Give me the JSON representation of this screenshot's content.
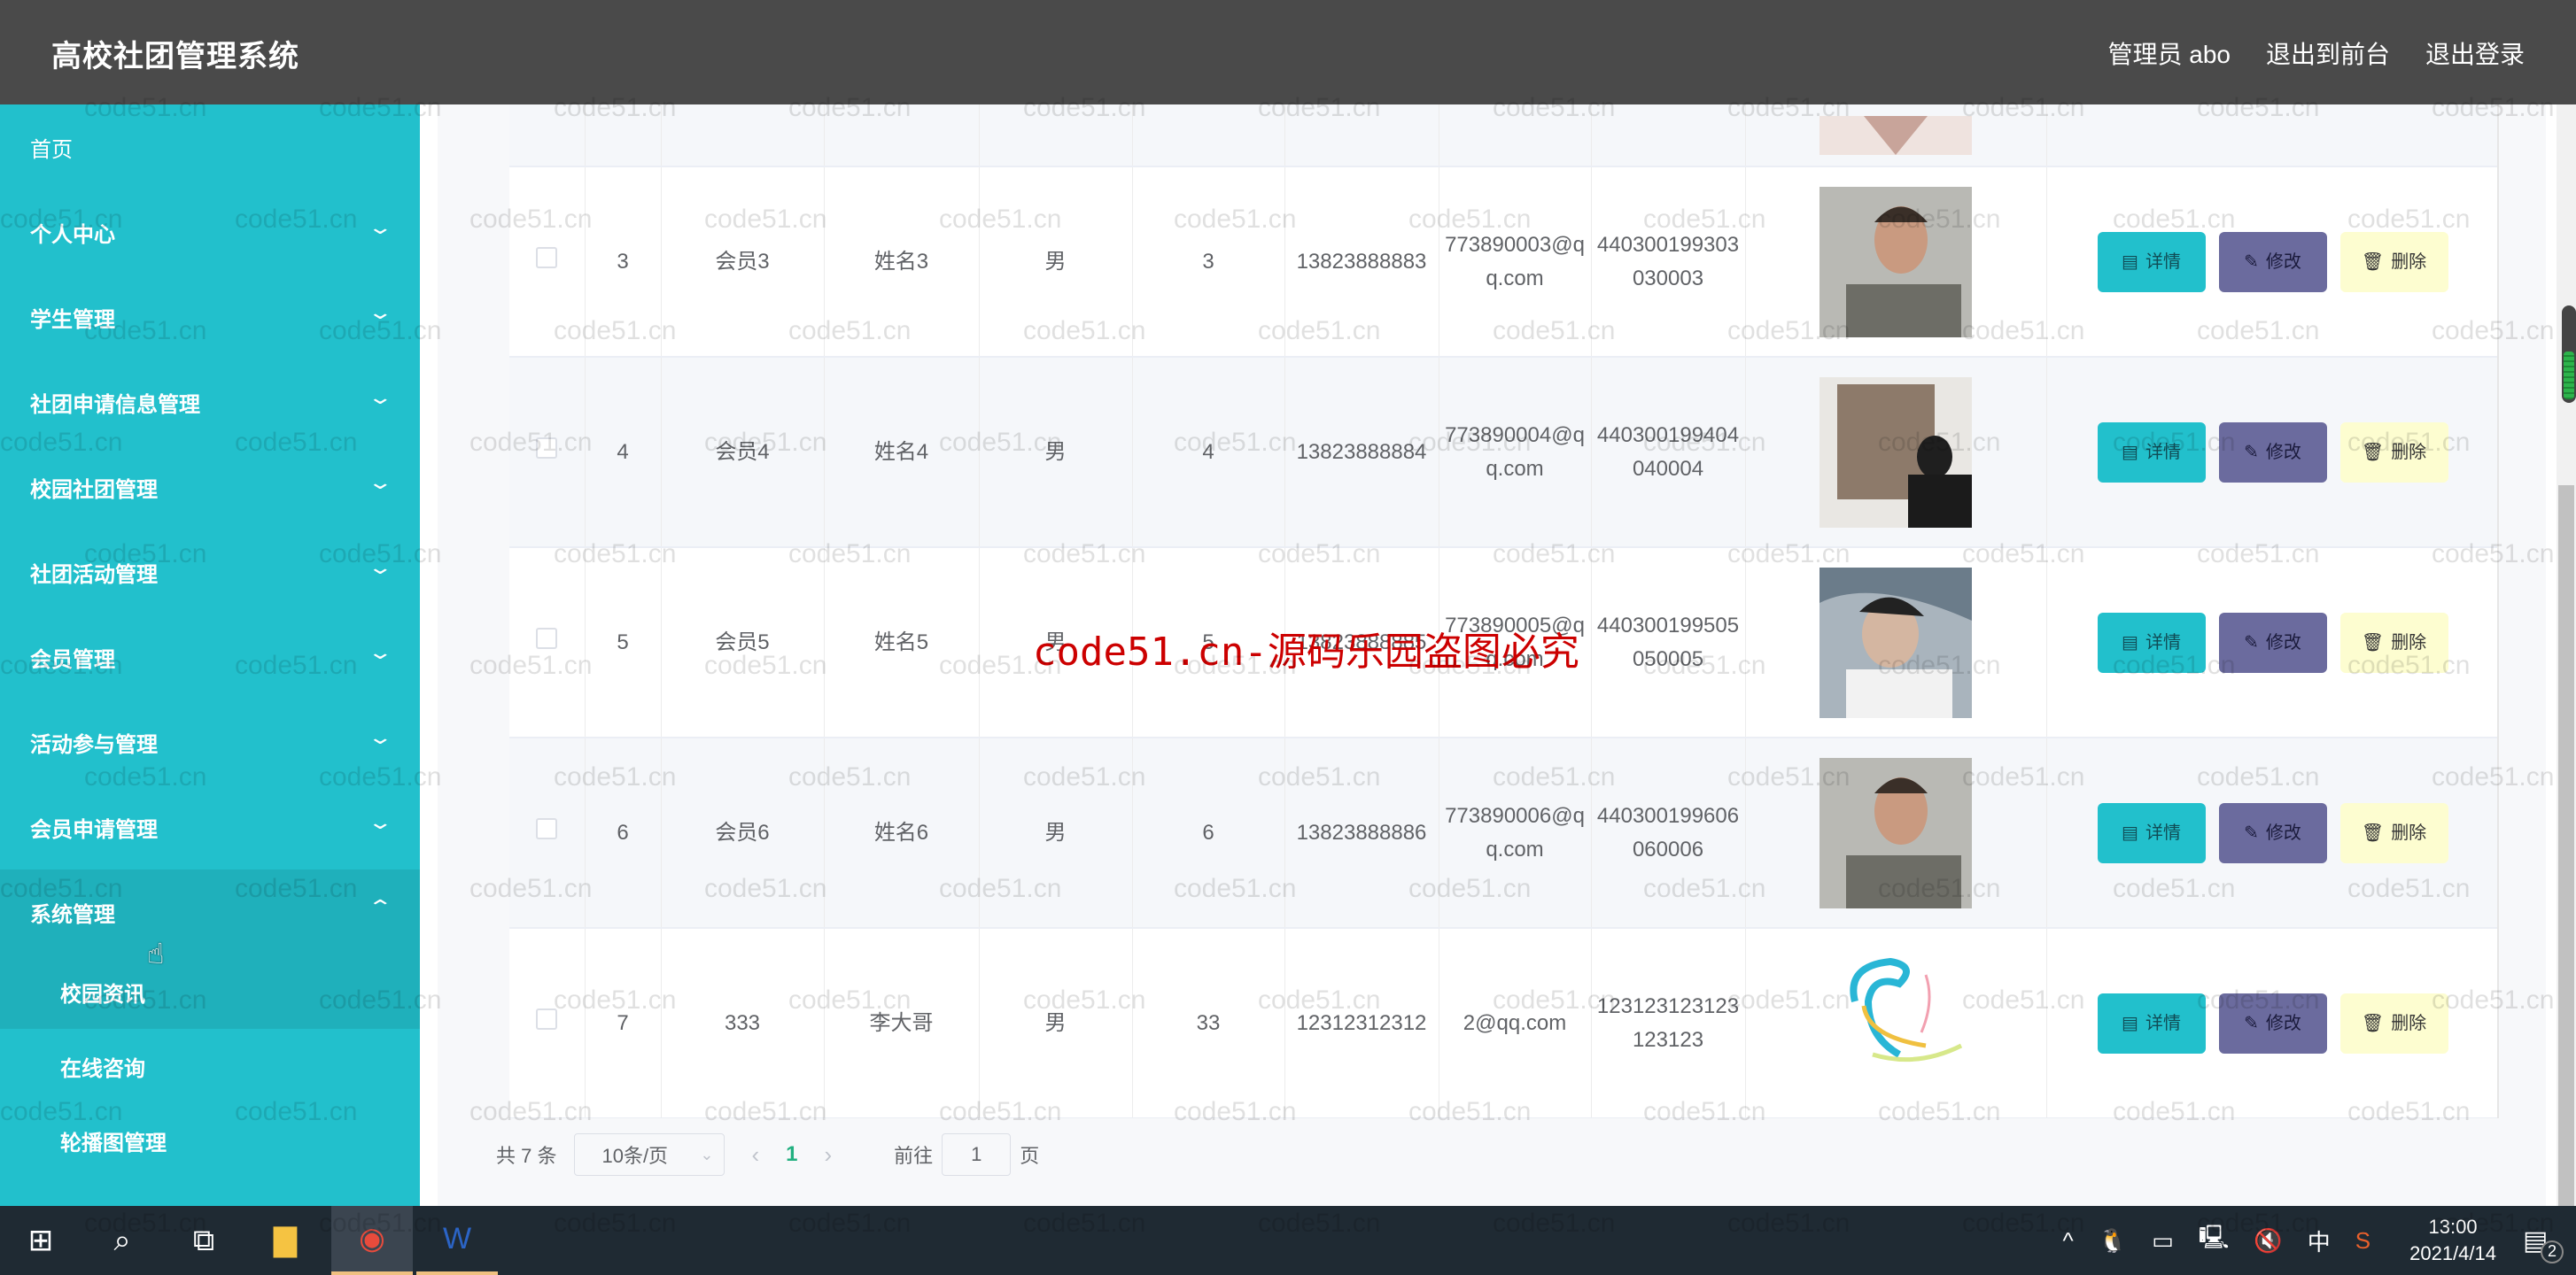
{
  "header": {
    "title": "高校社团管理系统",
    "user_label": "管理员 abo",
    "front_label": "退出到前台",
    "logout_label": "退出登录"
  },
  "sidebar": {
    "items": [
      {
        "label": "首页",
        "has_children": false
      },
      {
        "label": "个人中心",
        "has_children": true
      },
      {
        "label": "学生管理",
        "has_children": true
      },
      {
        "label": "社团申请信息管理",
        "has_children": true
      },
      {
        "label": "校园社团管理",
        "has_children": true
      },
      {
        "label": "社团活动管理",
        "has_children": true
      },
      {
        "label": "会员管理",
        "has_children": true
      },
      {
        "label": "活动参与管理",
        "has_children": true
      },
      {
        "label": "会员申请管理",
        "has_children": true
      },
      {
        "label": "系统管理",
        "has_children": true,
        "expanded": true
      }
    ],
    "sub_items": [
      "校园资讯",
      "在线咨询",
      "轮播图管理"
    ],
    "chevron_down": "⌄",
    "chevron_up": "⌃"
  },
  "table": {
    "rows": [
      {
        "index": "3",
        "account": "会员3",
        "name": "姓名3",
        "gender": "男",
        "age": "3",
        "phone": "13823888883",
        "email": "773890003@qq.com",
        "id_card": "440300199303030003",
        "photo": "photo-man-selfie"
      },
      {
        "index": "4",
        "account": "会员4",
        "name": "姓名4",
        "gender": "男",
        "age": "4",
        "phone": "13823888884",
        "email": "773890004@qq.com",
        "id_card": "440300199404040004",
        "photo": "photo-man-gallery"
      },
      {
        "index": "5",
        "account": "会员5",
        "name": "姓名5",
        "gender": "男",
        "age": "5",
        "phone": "13823888885",
        "email": "773890005@qq.com",
        "id_card": "440300199505050005",
        "photo": "photo-man-portrait"
      },
      {
        "index": "6",
        "account": "会员6",
        "name": "姓名6",
        "gender": "男",
        "age": "6",
        "phone": "13823888886",
        "email": "773890006@qq.com",
        "id_card": "440300199606060006",
        "photo": "photo-man-selfie"
      },
      {
        "index": "7",
        "account": "333",
        "name": "李大哥",
        "gender": "男",
        "age": "33",
        "phone": "12312312312",
        "email": "2@qq.com",
        "id_card": "123123123123123123",
        "photo": "photo-logo-swirl"
      }
    ],
    "actions": {
      "detail": "详情",
      "edit": "修改",
      "delete": "删除"
    }
  },
  "pagination": {
    "total": "共 7 条",
    "page_size": "10条/页",
    "current_page": "1",
    "goto_label": "前往",
    "goto_value": "1",
    "page_suffix": "页"
  },
  "overlay_watermark": "code51.cn-源码乐园盗图必究",
  "watermark": "code51.cn",
  "taskbar": {
    "time": "13:00",
    "date": "2021/4/14",
    "ime": "中",
    "notifications": "2"
  }
}
